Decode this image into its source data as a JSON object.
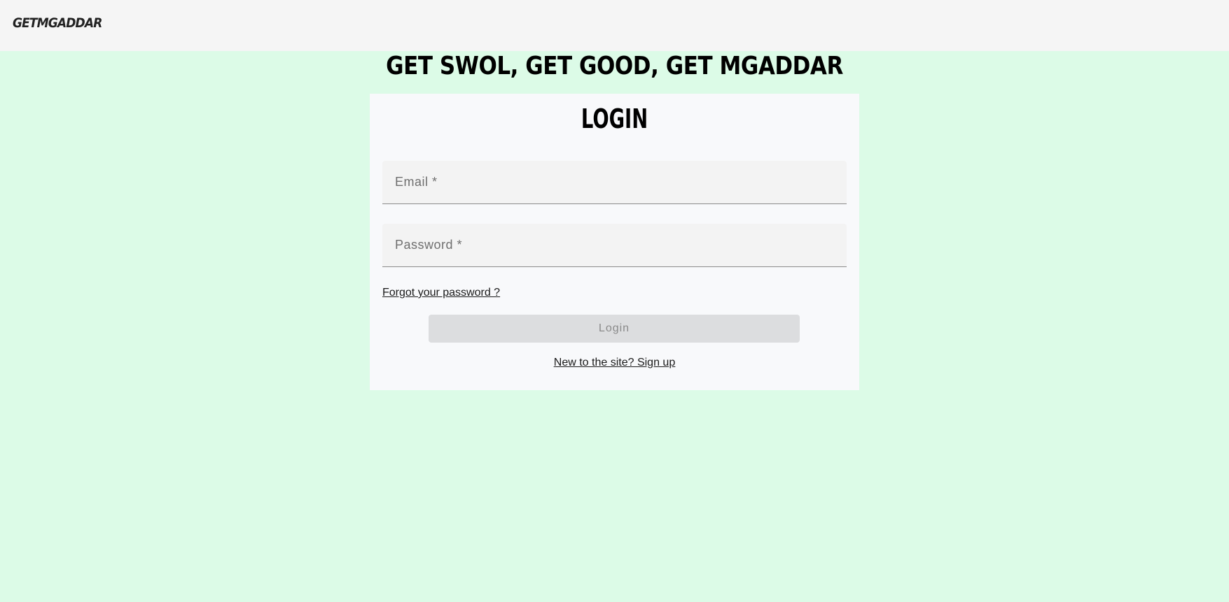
{
  "header": {
    "brand": "GETMGADDAR"
  },
  "hero": {
    "headline": "GET SWOL, GET GOOD, GET MGADDAR"
  },
  "login_card": {
    "title": "LOGIN",
    "email_placeholder": "Email *",
    "password_placeholder": "Password *",
    "forgot_link": "Forgot your password ?",
    "login_button": "Login",
    "signup_link": "New to the site? Sign up"
  },
  "colors": {
    "page_background": "#dcfbe7",
    "topbar_background": "#f5f5f5",
    "card_background": "#f8f9fb",
    "field_background": "#f3f3f3",
    "button_disabled_background": "#dcdddf",
    "button_disabled_text": "#8a8a8a"
  }
}
